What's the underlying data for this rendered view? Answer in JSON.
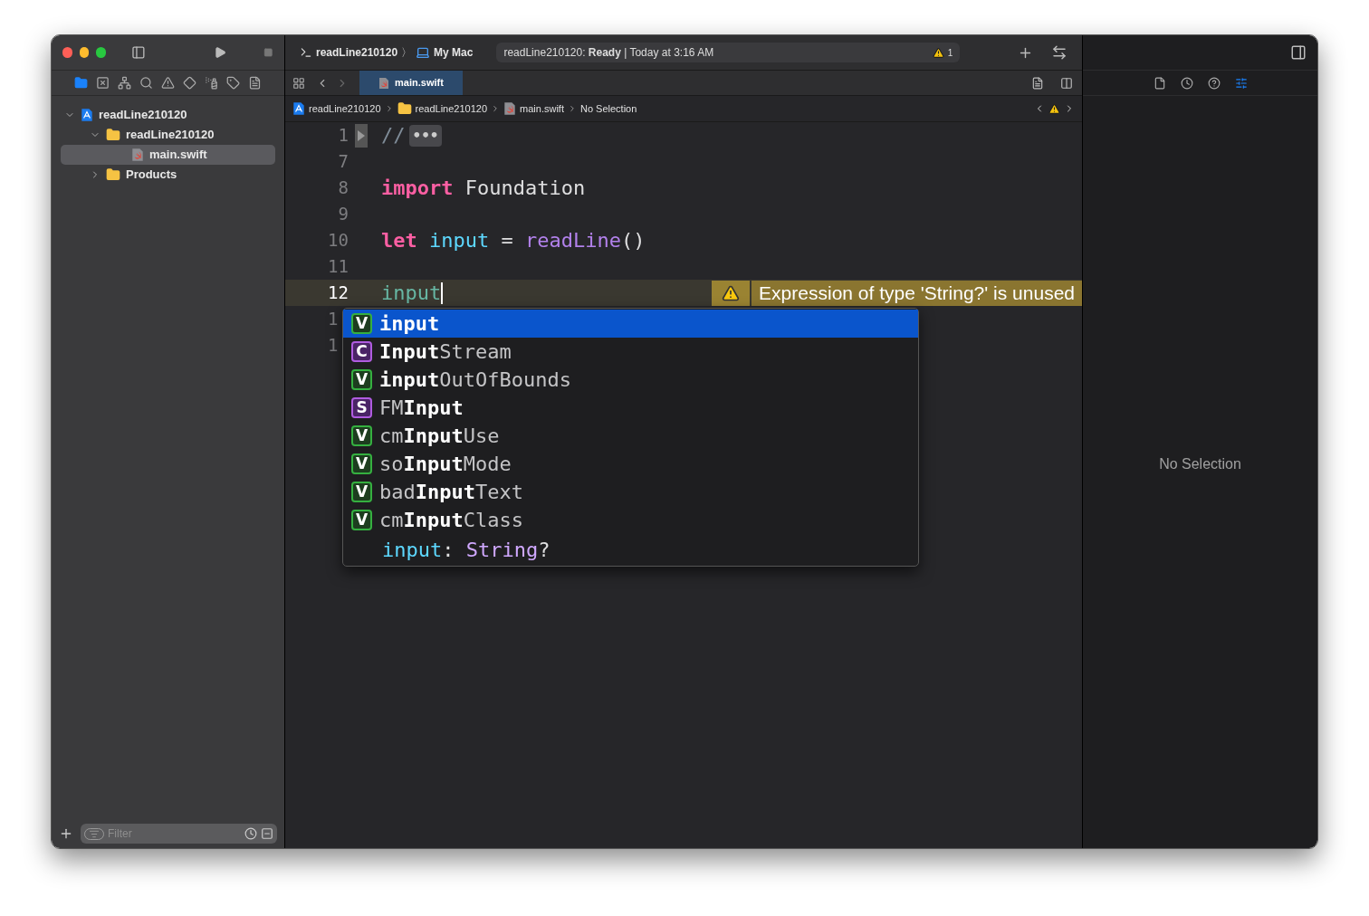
{
  "toolbar": {
    "scheme": {
      "target": "readLine210120",
      "separator": "〉",
      "device": "My Mac"
    },
    "activity": {
      "status": "readLine210120: **Ready** | Today at 3:16 AM",
      "warning_count": "1"
    }
  },
  "navigator_tabs": [
    {
      "selected": true
    },
    {
      "selected": false
    },
    {
      "selected": false
    },
    {
      "selected": false
    },
    {
      "selected": false
    },
    {
      "selected": false
    },
    {
      "selected": false
    },
    {
      "selected": false
    },
    {
      "selected": false
    }
  ],
  "tree": [
    {
      "label": "readLine210120",
      "kind": "project",
      "expanded": true,
      "selected": false,
      "children": [
        {
          "label": "readLine210120",
          "kind": "folder",
          "expanded": true,
          "selected": false,
          "children": [
            {
              "label": "main.swift",
              "kind": "swift",
              "selected": true
            }
          ]
        },
        {
          "label": "Products",
          "kind": "folder",
          "expanded": false,
          "selected": false
        }
      ]
    }
  ],
  "filter": {
    "placeholder": "Filter"
  },
  "editor_tabs": [
    {
      "label": "main.swift",
      "selected": true
    }
  ],
  "jump_bar": [
    {
      "label": "readLine210120",
      "kind": "project"
    },
    {
      "label": "readLine210120",
      "kind": "folder"
    },
    {
      "label": "main.swift",
      "kind": "swift"
    },
    {
      "label": "No Selection",
      "kind": "none"
    }
  ],
  "code_lines": [
    {
      "number": "1",
      "kind": "folded",
      "tokens": [
        {
          "text": "//",
          "kind": "comment"
        }
      ],
      "fold": "•••"
    },
    {
      "number": "7"
    },
    {
      "number": "8",
      "tokens": [
        {
          "text": "import",
          "kind": "keyword"
        },
        {
          "text": " Foundation",
          "kind": "plain"
        }
      ]
    },
    {
      "number": "9"
    },
    {
      "number": "10",
      "tokens": [
        {
          "text": "let ",
          "kind": "keyword"
        },
        {
          "text": "input",
          "kind": "variable"
        },
        {
          "text": " = ",
          "kind": "plain"
        },
        {
          "text": "readLine",
          "kind": "function"
        },
        {
          "text": "()",
          "kind": "plain"
        }
      ]
    },
    {
      "number": "11"
    },
    {
      "number": "12",
      "current": true,
      "tokens": [
        {
          "text": "input",
          "kind": "variable"
        }
      ],
      "warning": "Expression of type 'String?' is unused"
    },
    {
      "number": "1",
      "clipped": true
    },
    {
      "number": "1",
      "clipped": true
    }
  ],
  "completions": {
    "items": [
      {
        "badge": "V",
        "kind": "variable",
        "text": "**input**",
        "selected": true
      },
      {
        "badge": "C",
        "kind": "class",
        "text": "**Input**Stream",
        "selected": false
      },
      {
        "badge": "V",
        "kind": "variable",
        "text": "**input**OutOfBounds",
        "selected": false
      },
      {
        "badge": "S",
        "kind": "struct",
        "text": "FM**Input**",
        "selected": false
      },
      {
        "badge": "V",
        "kind": "variable",
        "text": "cm**Input**Use",
        "selected": false
      },
      {
        "badge": "V",
        "kind": "variable",
        "text": "so**Input**Mode",
        "selected": false
      },
      {
        "badge": "V",
        "kind": "variable",
        "text": "bad**Input**Text",
        "selected": false
      },
      {
        "badge": "V",
        "kind": "variable",
        "text": "cm**Input**Class",
        "selected": false
      }
    ],
    "signature": [
      {
        "text": "input",
        "kind": "variable"
      },
      {
        "text": ": ",
        "kind": "plain"
      },
      {
        "text": "String",
        "kind": "type"
      },
      {
        "text": "?",
        "kind": "plain"
      }
    ]
  },
  "inspector_tabs": [
    {
      "selected": false
    },
    {
      "selected": false
    },
    {
      "selected": false
    },
    {
      "selected": true
    }
  ],
  "inspector": {
    "message": "No Selection"
  }
}
